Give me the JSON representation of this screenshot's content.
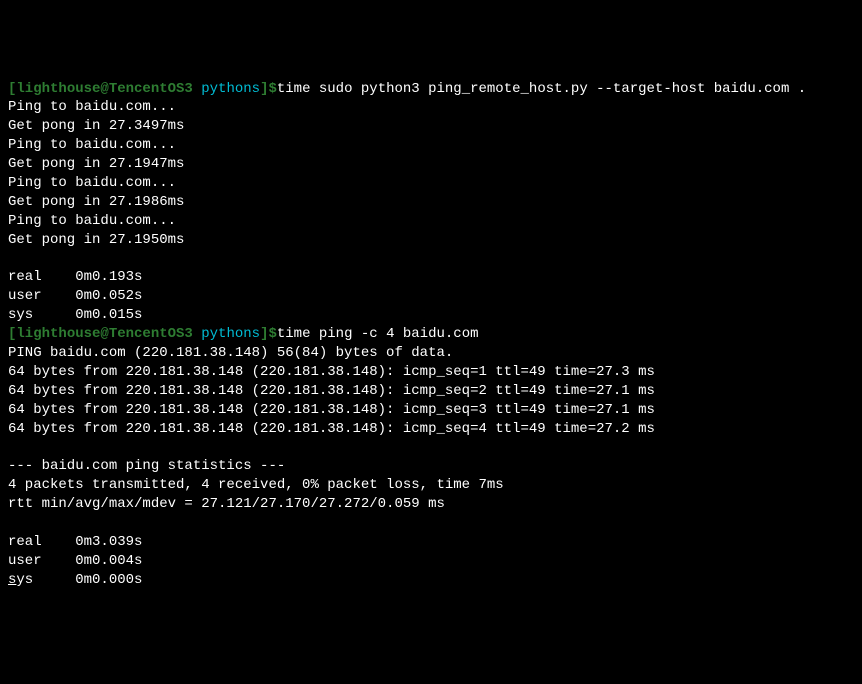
{
  "prompt1": {
    "bracket_open": "[",
    "user_host": "lighthouse@TencentOS3 ",
    "path": "pythons",
    "bracket_close": "]$",
    "command": "time sudo python3 ping_remote_host.py --target-host baidu.com ."
  },
  "output1": [
    "Ping to baidu.com...",
    "Get pong in 27.3497ms",
    "Ping to baidu.com...",
    "Get pong in 27.1947ms",
    "Ping to baidu.com...",
    "Get pong in 27.1986ms",
    "Ping to baidu.com...",
    "Get pong in 27.1950ms",
    "",
    "real    0m0.193s",
    "user    0m0.052s",
    "sys     0m0.015s"
  ],
  "prompt2": {
    "bracket_open": "[",
    "user_host": "lighthouse@TencentOS3 ",
    "path": "pythons",
    "bracket_close": "]$",
    "command": "time ping -c 4 baidu.com"
  },
  "output2": [
    "PING baidu.com (220.181.38.148) 56(84) bytes of data.",
    "64 bytes from 220.181.38.148 (220.181.38.148): icmp_seq=1 ttl=49 time=27.3 ms",
    "64 bytes from 220.181.38.148 (220.181.38.148): icmp_seq=2 ttl=49 time=27.1 ms",
    "64 bytes from 220.181.38.148 (220.181.38.148): icmp_seq=3 ttl=49 time=27.1 ms",
    "64 bytes from 220.181.38.148 (220.181.38.148): icmp_seq=4 ttl=49 time=27.2 ms",
    "",
    "--- baidu.com ping statistics ---",
    "4 packets transmitted, 4 received, 0% packet loss, time 7ms",
    "rtt min/avg/max/mdev = 27.121/27.170/27.272/0.059 ms",
    "",
    "real    0m3.039s",
    "user    0m0.004s"
  ],
  "last_line": {
    "cursor": "s",
    "rest": "ys     0m0.000s"
  }
}
